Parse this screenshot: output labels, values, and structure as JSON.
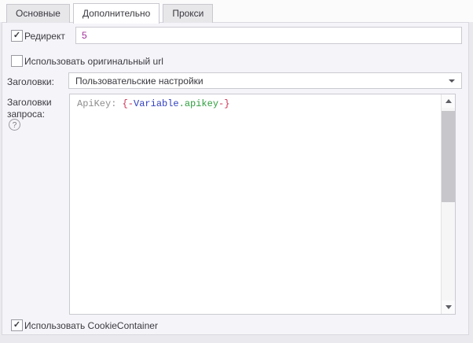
{
  "tabs": [
    {
      "label": "Основные",
      "active": false
    },
    {
      "label": "Дополнительно",
      "active": true
    },
    {
      "label": "Прокси",
      "active": false
    }
  ],
  "form": {
    "redirect": {
      "label": "Редирект",
      "checked": true,
      "value": "5"
    },
    "use_original_url": {
      "label": "Использовать оригинальный url",
      "checked": false
    },
    "headers": {
      "label": "Заголовки:",
      "selected_option": "Пользовательские настройки"
    },
    "request_headers": {
      "label": "Заголовки запроса:",
      "code_tokens": [
        {
          "text": "ApiKey: ",
          "color": "#8E8E8E"
        },
        {
          "text": "{-",
          "color": "#CE2F52"
        },
        {
          "text": "Variable",
          "color": "#3140C0"
        },
        {
          "text": ".apikey",
          "color": "#2E9E3E"
        },
        {
          "text": "-}",
          "color": "#CE2F52"
        }
      ]
    },
    "use_cookie_container": {
      "label": "Использовать CookieContainer",
      "checked": true
    }
  },
  "icons": {
    "checkmark": "✓",
    "help": "?",
    "dropdown_arrow": "triangle-down",
    "scroll_up": "triangle-up",
    "scroll_down": "triangle-down"
  },
  "colors": {
    "redirect_value": "#A0309A",
    "panel_bg": "#F5F5F9",
    "outer_bg": "#E9E9EE",
    "field_border": "#C9C9D1"
  }
}
